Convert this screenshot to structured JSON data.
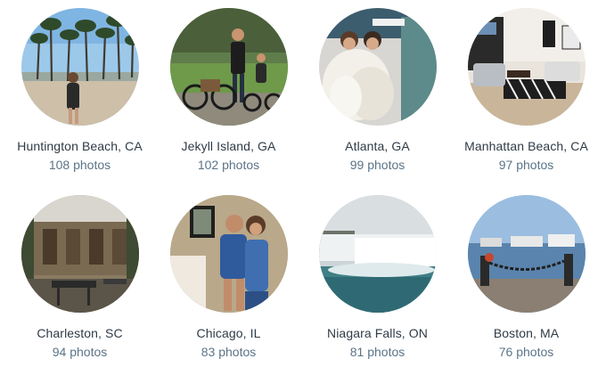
{
  "locations": [
    {
      "name": "Huntington Beach, CA",
      "count": "108 photos",
      "image": "beach-palm-trees-photo"
    },
    {
      "name": "Jekyll Island, GA",
      "count": "102 photos",
      "image": "family-bikes-photo"
    },
    {
      "name": "Atlanta, GA",
      "count": "99 photos",
      "image": "fur-display-photo"
    },
    {
      "name": "Manhattan Beach, CA",
      "count": "97 photos",
      "image": "living-room-photo"
    },
    {
      "name": "Charleston, SC",
      "count": "94 photos",
      "image": "courtyard-photo"
    },
    {
      "name": "Chicago, IL",
      "count": "83 photos",
      "image": "couple-selfie-photo"
    },
    {
      "name": "Niagara Falls, ON",
      "count": "81 photos",
      "image": "waterfall-photo"
    },
    {
      "name": "Boston, MA",
      "count": "76 photos",
      "image": "harbor-chain-photo"
    }
  ]
}
